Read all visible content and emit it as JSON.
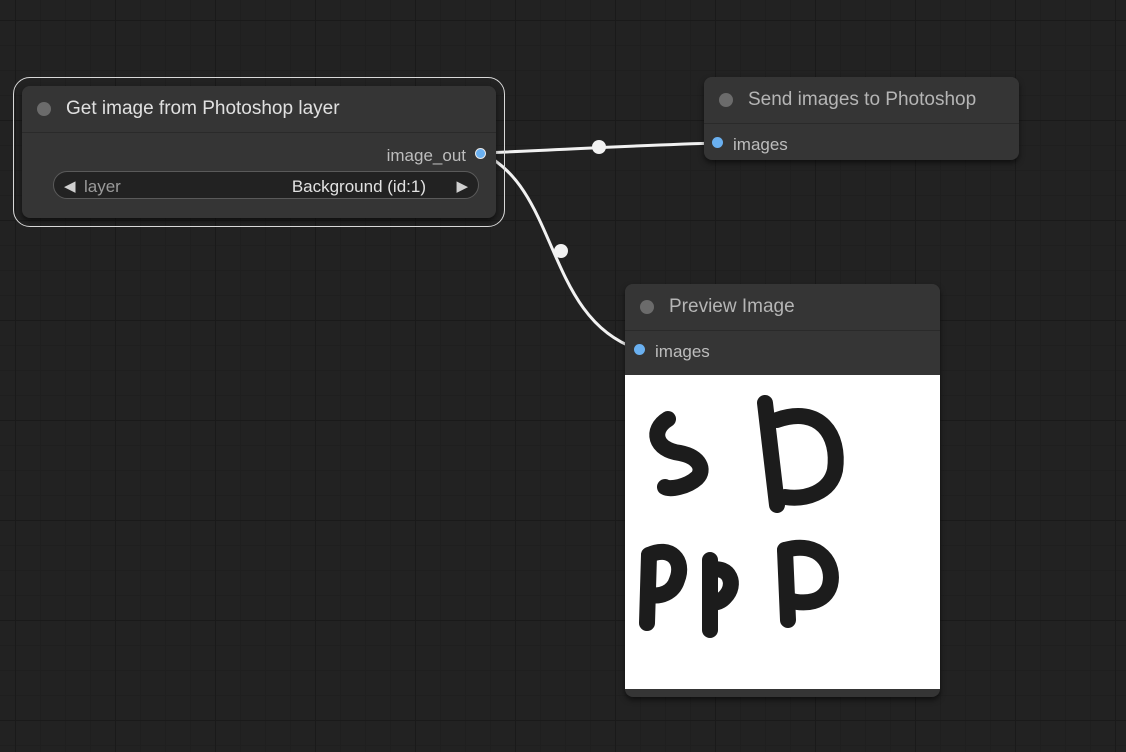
{
  "nodes": {
    "get_image": {
      "title": "Get image from Photoshop layer",
      "output_label": "image_out",
      "widget": {
        "name": "layer",
        "value": "Background (id:1)"
      }
    },
    "send_images": {
      "title": "Send images to Photoshop",
      "input_label": "images"
    },
    "preview": {
      "title": "Preview Image",
      "input_label": "images"
    }
  },
  "colors": {
    "canvas": "#222222",
    "node_body": "#353535",
    "slot_image": "#6ab0f0",
    "link": "#ffffff"
  }
}
